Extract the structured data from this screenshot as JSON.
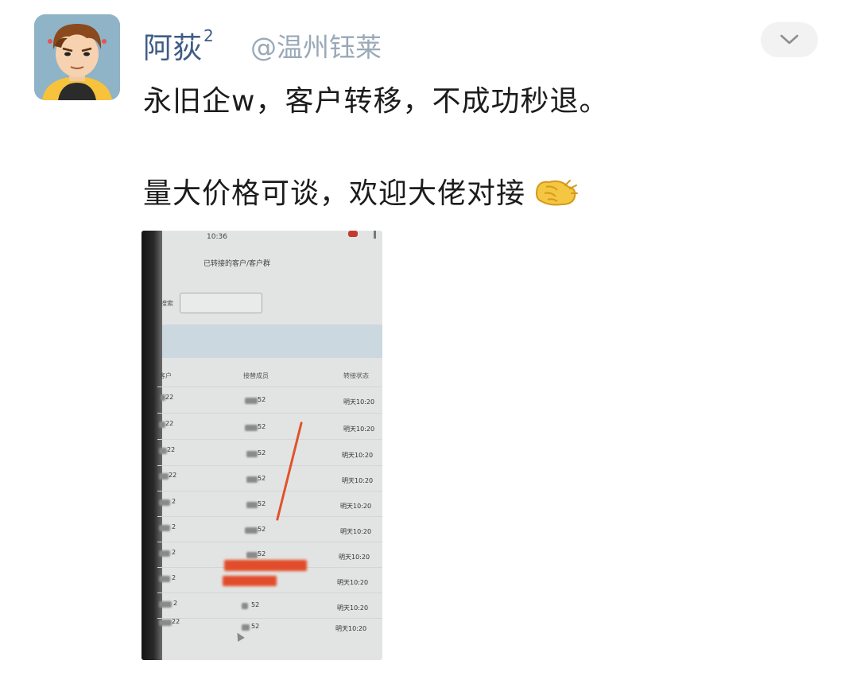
{
  "author": {
    "name": "阿荻",
    "badge": "2",
    "mention": "@温州钰莱",
    "avatar_icon": "cartoon-avatar-icon"
  },
  "menu": {
    "icon": "chevron-down-icon"
  },
  "post": {
    "line1": "永旧企w，客户转移，不成功秒退。",
    "line2": "量大价格可谈，欢迎大佬对接",
    "emoji_icon": "clap-hand-emoji-icon"
  },
  "photo": {
    "time": "10:36",
    "title": "已转接的客户/客户群",
    "search_label": "搜索",
    "columns": [
      "客户",
      "接替成员",
      "转接状态"
    ],
    "rows": [
      {
        "customer": "22",
        "member": "52",
        "status": "明天10:20"
      },
      {
        "customer": "22",
        "member": "52",
        "status": "明天10:20"
      },
      {
        "customer": "22",
        "member": "52",
        "status": "明天10:20"
      },
      {
        "customer": "22",
        "member": "52",
        "status": "明天10:20"
      },
      {
        "customer": "2",
        "member": "52",
        "status": "明天10:20"
      },
      {
        "customer": "2",
        "member": "52",
        "status": "明天10:20"
      },
      {
        "customer": "2",
        "member": "52",
        "status": "明天10:20"
      },
      {
        "customer": "2",
        "member": "",
        "status": "明天10:20"
      },
      {
        "customer": "2",
        "member": "52",
        "status": "明天10:20"
      },
      {
        "customer": "22",
        "member": "52",
        "status": "明天10:20"
      }
    ]
  },
  "colors": {
    "name": "#3f5c86",
    "mention": "#9aa9b8",
    "text": "#1c1c1c",
    "annotation_red": "#e0532a"
  }
}
